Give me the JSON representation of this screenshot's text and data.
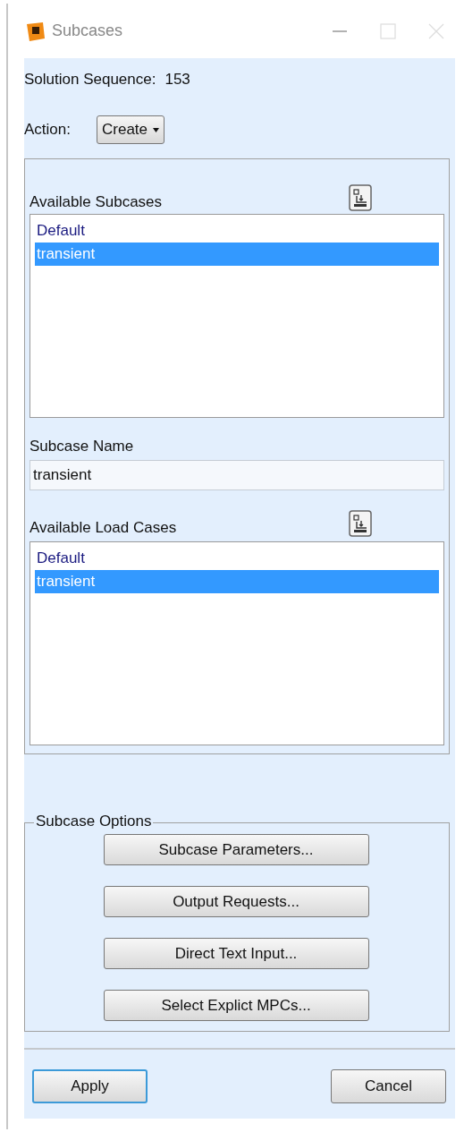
{
  "window": {
    "title": "Subcases"
  },
  "solution_sequence": {
    "label": "Solution Sequence:",
    "value": "153"
  },
  "action": {
    "label": "Action:",
    "value": "Create"
  },
  "available_subcases": {
    "label": "Available Subcases",
    "items": [
      {
        "label": "Default",
        "selected": false
      },
      {
        "label": "transient",
        "selected": true
      }
    ]
  },
  "subcase_name": {
    "label": "Subcase Name",
    "value": "transient"
  },
  "available_load_cases": {
    "label": "Available Load Cases",
    "items": [
      {
        "label": "Default",
        "selected": false
      },
      {
        "label": "transient",
        "selected": true
      }
    ]
  },
  "subcase_options": {
    "title": "Subcase Options",
    "buttons": [
      "Subcase Parameters...",
      "Output Requests...",
      "Direct Text Input...",
      "Select Explict MPCs..."
    ]
  },
  "footer_buttons": [
    {
      "label": "Apply",
      "focused": true
    },
    {
      "label": "Cancel",
      "focused": false
    }
  ]
}
